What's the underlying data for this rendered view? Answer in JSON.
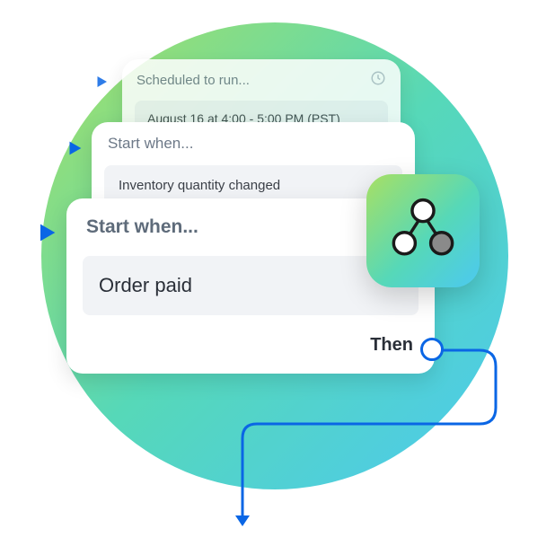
{
  "cards": {
    "back": {
      "header": "Scheduled to run...",
      "value": "August 16 at 4:00 - 5:00 PM (PST)"
    },
    "mid": {
      "header": "Start when...",
      "value": "Inventory quantity changed"
    },
    "front": {
      "header": "Start when...",
      "value": "Order paid",
      "then_label": "Then"
    }
  },
  "colors": {
    "accent_blue": "#0a66e5"
  }
}
